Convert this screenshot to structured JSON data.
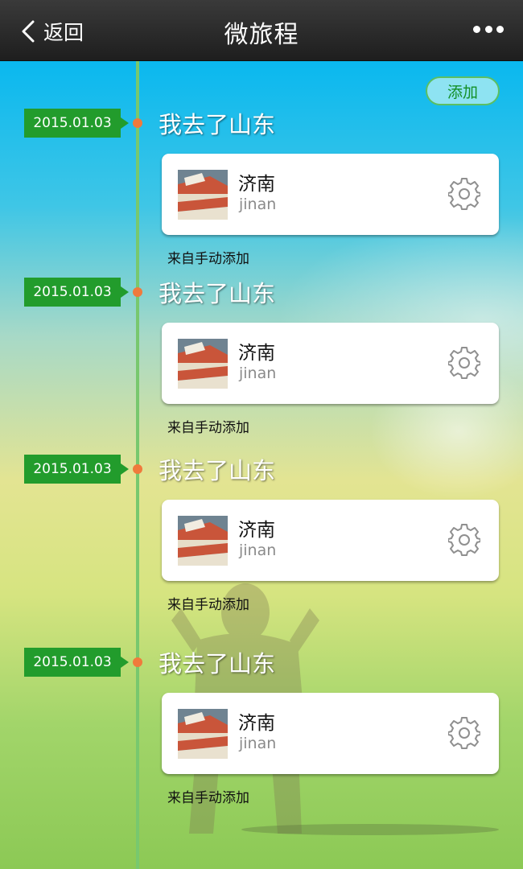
{
  "header": {
    "back_label": "返回",
    "title": "微旅程",
    "more_icon": "more-icon"
  },
  "add_button": "添加",
  "colors": {
    "date_tag": "#229c2c",
    "dot": "#f07a3c",
    "timeline": "#78c86e",
    "add_text": "#138f26"
  },
  "entries": [
    {
      "date": "2015.01.03",
      "title": "我去了山东",
      "place": "济南",
      "place_sub": "jinan",
      "source": "来自手动添加"
    },
    {
      "date": "2015.01.03",
      "title": "我去了山东",
      "place": "济南",
      "place_sub": "jinan",
      "source": "来自手动添加"
    },
    {
      "date": "2015.01.03",
      "title": "我去了山东",
      "place": "济南",
      "place_sub": "jinan",
      "source": "来自手动添加"
    },
    {
      "date": "2015.01.03",
      "title": "我去了山东",
      "place": "济南",
      "place_sub": "jinan",
      "source": "来自手动添加"
    }
  ]
}
